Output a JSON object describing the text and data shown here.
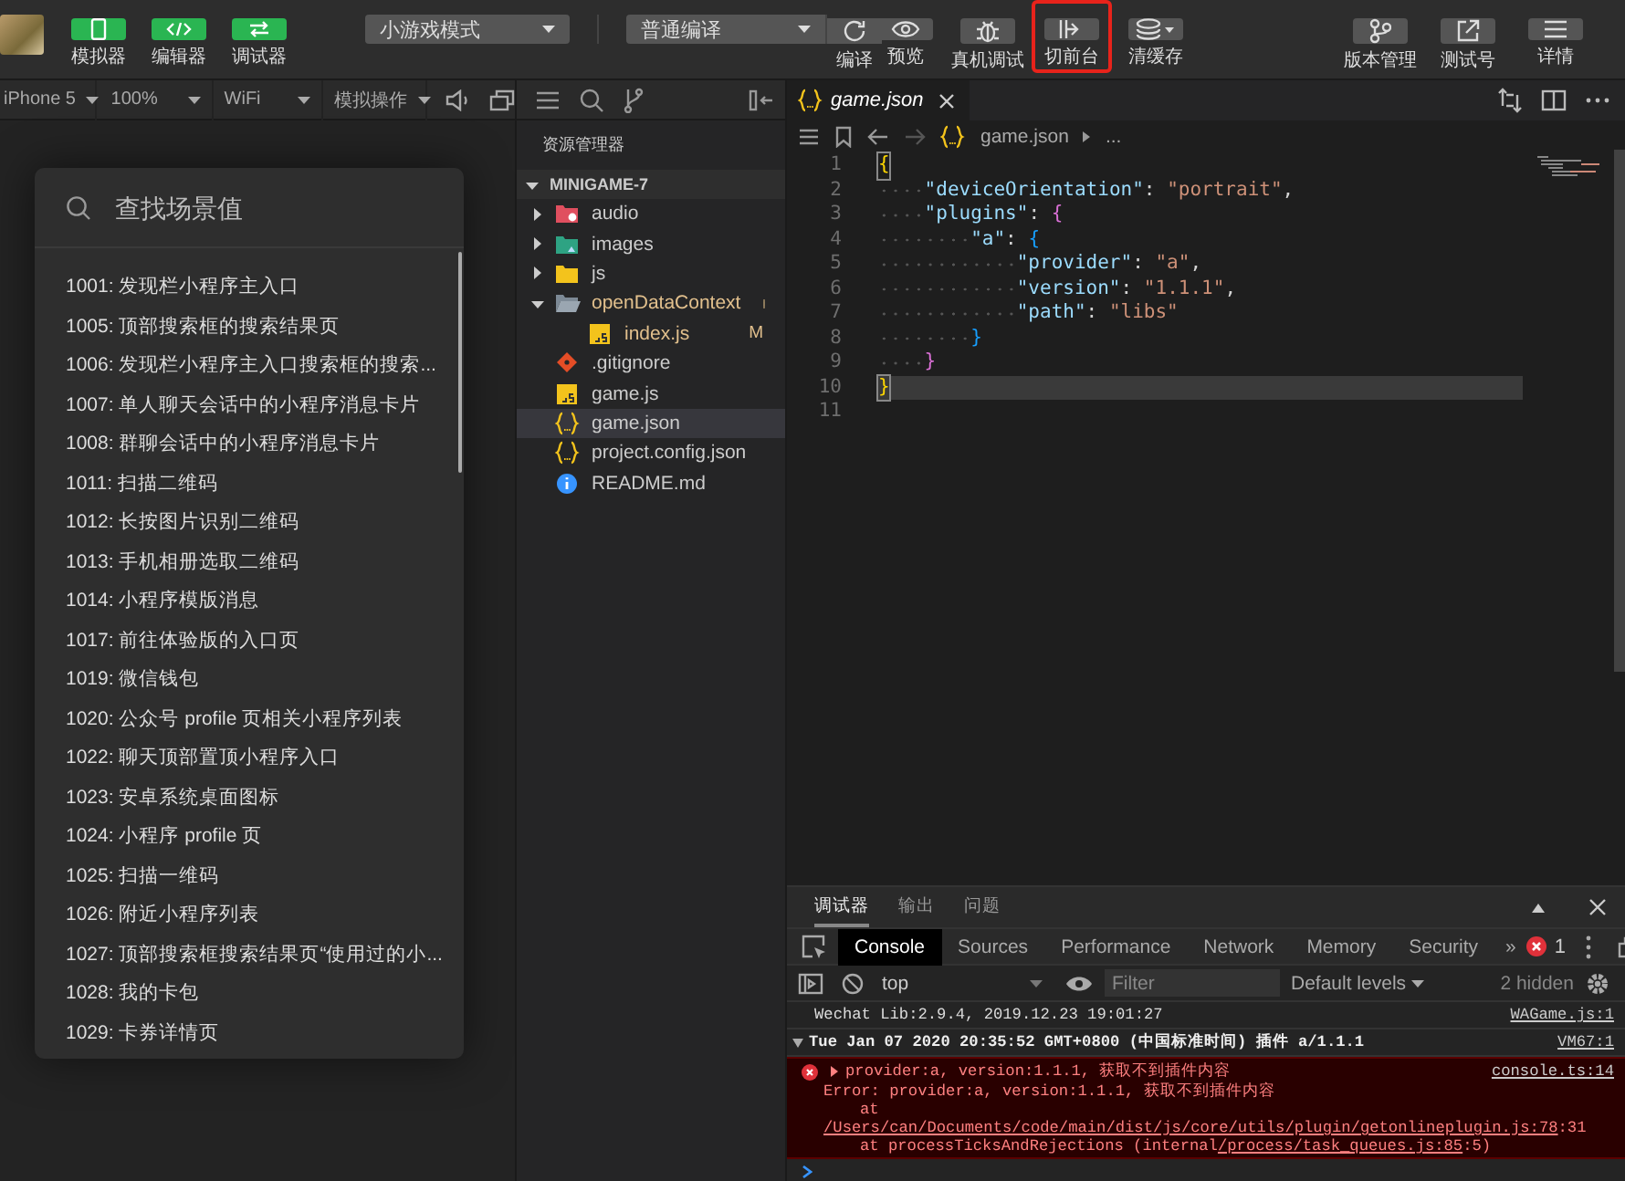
{
  "toolbar": {
    "left_buttons": [
      {
        "kind": "simulator",
        "label": "模拟器",
        "on": true
      },
      {
        "kind": "editor",
        "label": "编辑器",
        "on": true
      },
      {
        "kind": "debugger",
        "label": "调试器",
        "on": true
      }
    ],
    "mode_select": "小游戏模式",
    "compile_select": "普通编译",
    "center_buttons": [
      {
        "kind": "compile",
        "label": "编译",
        "highlighted": false
      },
      {
        "kind": "preview",
        "label": "预览",
        "highlighted": false
      },
      {
        "kind": "remote-debug",
        "label": "真机调试",
        "highlighted": false
      },
      {
        "kind": "foreground",
        "label": "切前台",
        "highlighted": true
      },
      {
        "kind": "cache",
        "label": "清缓存",
        "highlighted": false
      }
    ],
    "right_buttons": [
      {
        "kind": "version",
        "label": "版本管理"
      },
      {
        "kind": "test-account",
        "label": "测试号"
      },
      {
        "kind": "details",
        "label": "详情"
      }
    ]
  },
  "simulator_bar": {
    "selects": [
      "iPhone 5",
      "100%",
      "WiFi",
      "模拟操作"
    ]
  },
  "scene_panel": {
    "search": {
      "placeholder": "查找场景值"
    },
    "items": [
      "1001: 发现栏小程序主入口",
      "1005: 顶部搜索框的搜索结果页",
      "1006: 发现栏小程序主入口搜索框的搜索...",
      "1007: 单人聊天会话中的小程序消息卡片",
      "1008: 群聊会话中的小程序消息卡片",
      "1011: 扫描二维码",
      "1012: 长按图片识别二维码",
      "1013: 手机相册选取二维码",
      "1014: 小程序模版消息",
      "1017: 前往体验版的入口页",
      "1019: 微信钱包",
      "1020: 公众号 profile 页相关小程序列表",
      "1022: 聊天顶部置顶小程序入口",
      "1023: 安卓系统桌面图标",
      "1024: 小程序 profile 页",
      "1025: 扫描一维码",
      "1026: 附近小程序列表",
      "1027: 顶部搜索框搜索结果页“使用过的小...",
      "1028: 我的卡包",
      "1029: 卡券详情页"
    ]
  },
  "explorer": {
    "title": "资源管理器",
    "project": {
      "name": "MINIGAME-7",
      "expanded": true
    },
    "tree": [
      {
        "name": "audio",
        "kind": "audio-folder",
        "expanded": false,
        "selected": false,
        "modified": false
      },
      {
        "name": "images",
        "kind": "image-folder",
        "expanded": false,
        "selected": false,
        "modified": false
      },
      {
        "name": "js",
        "kind": "js-folder",
        "expanded": false,
        "selected": false,
        "modified": false
      },
      {
        "name": "openDataContext",
        "kind": "folder",
        "expanded": true,
        "selected": false,
        "modified": true,
        "children": [
          {
            "name": "index.js",
            "kind": "js-file",
            "selected": false,
            "modified": true,
            "badge": "M"
          }
        ]
      },
      {
        "name": ".gitignore",
        "kind": "git-file",
        "selected": false,
        "modified": false
      },
      {
        "name": "game.js",
        "kind": "js-file",
        "selected": false,
        "modified": false
      },
      {
        "name": "game.json",
        "kind": "json-file",
        "selected": true,
        "modified": false
      },
      {
        "name": "project.config.json",
        "kind": "json-file",
        "selected": false,
        "modified": false
      },
      {
        "name": "README.md",
        "kind": "info-file",
        "selected": false,
        "modified": false
      }
    ]
  },
  "editor": {
    "tabs": [
      {
        "label": "game.json",
        "selected": true
      }
    ],
    "breadcrumb": [
      "game.json",
      "..."
    ],
    "lines": [
      {
        "number": "1",
        "text": "{",
        "current": false
      },
      {
        "number": "2",
        "text": "    \"deviceOrientation\": \"portrait\",",
        "current": false
      },
      {
        "number": "3",
        "text": "    \"plugins\": {",
        "current": false
      },
      {
        "number": "4",
        "text": "        \"a\": {",
        "current": false
      },
      {
        "number": "5",
        "text": "            \"provider\": \"a\",",
        "current": false
      },
      {
        "number": "6",
        "text": "            \"version\": \"1.1.1\",",
        "current": false
      },
      {
        "number": "7",
        "text": "            \"path\": \"libs\"",
        "current": false
      },
      {
        "number": "8",
        "text": "        }",
        "current": false
      },
      {
        "number": "9",
        "text": "    }",
        "current": false
      },
      {
        "number": "10",
        "text": "}",
        "current": true
      },
      {
        "number": "11",
        "current": false
      }
    ]
  },
  "debugger": {
    "tabs": [
      {
        "label": "调试器",
        "selected": true
      },
      {
        "label": "输出",
        "selected": false
      },
      {
        "label": "问题",
        "selected": false
      }
    ],
    "devtools_tabs": [
      {
        "label": "Console",
        "selected": true
      },
      {
        "label": "Sources",
        "selected": false
      },
      {
        "label": "Performance",
        "selected": false
      },
      {
        "label": "Network",
        "selected": false
      },
      {
        "label": "Memory",
        "selected": false
      },
      {
        "label": "Security",
        "selected": false
      }
    ],
    "more_tabs": "»",
    "error_count": "1",
    "context_select": "top",
    "filter": {
      "placeholder": "Filter"
    },
    "levels_select": "Default levels",
    "hidden_count": "2 hidden",
    "logs": [
      {
        "kind": "info",
        "text": "Wechat Lib:2.9.4, 2019.12.23 19:01:27",
        "source": "WAGame.js:1"
      },
      {
        "kind": "group",
        "expanded": true,
        "text": "Tue Jan 07 2020 20:35:52 GMT+0800 (中国标准时间) 插件 a/1.1.1",
        "source": "VM67:1"
      },
      {
        "kind": "error",
        "expanded": false,
        "text": "provider:a, version:1.1.1, 获取不到插件内容",
        "source": "console.ts:14",
        "details": [
          {
            "indented": false,
            "segments": [
              {
                "text": "Error: provider:a, version:1.1.1, 获取不到插件内容",
                "link": false
              }
            ]
          },
          {
            "indented": true,
            "segments": [
              {
                "text": "at",
                "link": false
              }
            ]
          },
          {
            "indented": false,
            "segments": [
              {
                "text": "/Users/can/Documents/code/main/dist/js/core/utils/plugin/getonlineplugin.js:78",
                "link": true
              },
              {
                "text": ":31",
                "link": false
              }
            ]
          },
          {
            "indented": true,
            "segments": [
              {
                "text": "at processTicksAndRejections (internal",
                "link": false
              },
              {
                "text": "/process/task_queues.js:85",
                "link": true
              },
              {
                "text": ":5)",
                "link": false
              }
            ]
          }
        ]
      }
    ]
  }
}
